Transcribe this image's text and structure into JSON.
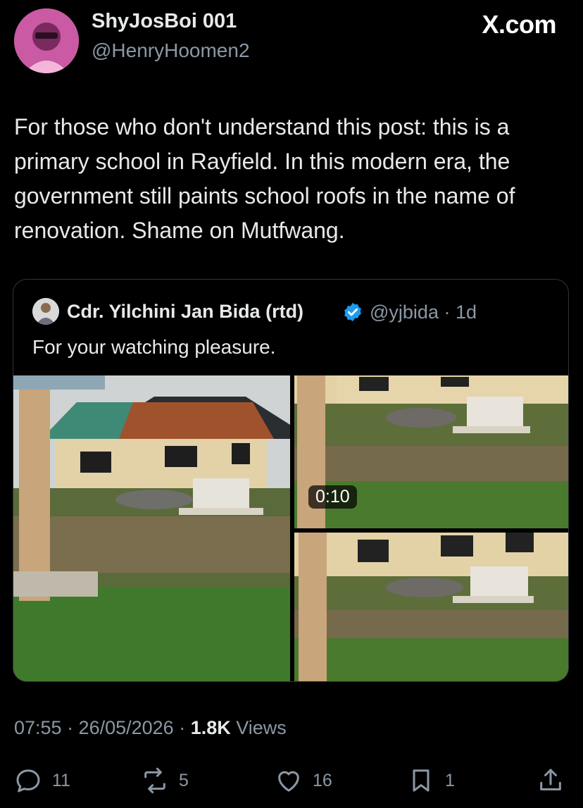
{
  "author": {
    "display_name": "ShyJosBoi 001",
    "handle": "@HenryHoomen2"
  },
  "brand": "X.com",
  "post": {
    "text": "For those who don't understand this post: this is a primary school in Rayfield. In this modern era, the government still paints school roofs in the name of renovation. Shame on Mutfwang."
  },
  "quote": {
    "display_name": "Cdr. Yilchini Jan Bida (rtd)",
    "handle_time": "@yjbida · 1d",
    "text": "For your watching pleasure.",
    "video_duration": "0:10"
  },
  "meta": {
    "time_date": "07:55 · 26/05/2026 · ",
    "views_count": "1.8K",
    "views_label": " Views"
  },
  "actions": {
    "replies": "11",
    "reposts": "5",
    "likes": "16",
    "bookmarks": "1"
  },
  "colors": {
    "background": "#000000",
    "text": "#e7e9ea",
    "muted": "#8b98a5",
    "verified": "#1d9bf0",
    "border": "#2f3336"
  }
}
